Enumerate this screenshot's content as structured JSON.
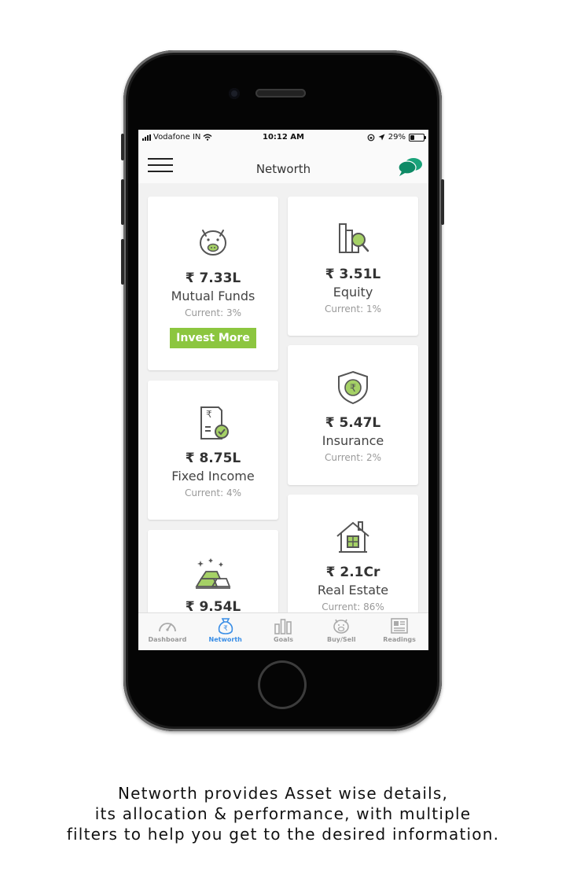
{
  "status_bar": {
    "carrier": "Vodafone IN",
    "time": "10:12 AM",
    "battery": "29%",
    "battery_level": 0.29
  },
  "nav": {
    "title": "Networth"
  },
  "cards": [
    {
      "amount": "₹ 7.33L",
      "name": "Mutual Funds",
      "current": "Current: 3%",
      "button": "Invest More",
      "icon": "piggy-bank-icon"
    },
    {
      "amount": "₹ 3.51L",
      "name": "Equity",
      "current": "Current: 1%",
      "icon": "equity-chart-icon"
    },
    {
      "amount": "₹ 5.47L",
      "name": "Insurance",
      "current": "Current: 2%",
      "icon": "insurance-shield-icon"
    },
    {
      "amount": "₹ 8.75L",
      "name": "Fixed Income",
      "current": "Current: 4%",
      "icon": "fixed-income-doc-icon"
    },
    {
      "amount": "₹ 2.1Cr",
      "name": "Real Estate",
      "current": "Current: 86%",
      "icon": "house-icon"
    },
    {
      "amount": "₹ 9.54L",
      "name": "",
      "current": "",
      "icon": "gold-bars-icon"
    }
  ],
  "tabs": [
    {
      "label": "Dashboard",
      "icon": "speedometer-icon",
      "active": false
    },
    {
      "label": "Networth",
      "icon": "money-bag-icon",
      "active": true
    },
    {
      "label": "Goals",
      "icon": "bar-chart-icon",
      "active": false
    },
    {
      "label": "Buy/Sell",
      "icon": "piggy-icon",
      "active": false
    },
    {
      "label": "Readings",
      "icon": "newspaper-icon",
      "active": false
    }
  ],
  "colors": {
    "accent_green": "#8cc63f",
    "active_tab": "#3a8ee6",
    "chat_green": "#1aa37a"
  },
  "caption": {
    "line1": "Networth provides Asset wise details,",
    "line2": "its allocation & performance, with multiple",
    "line3": "filters to help you get to the desired information."
  }
}
